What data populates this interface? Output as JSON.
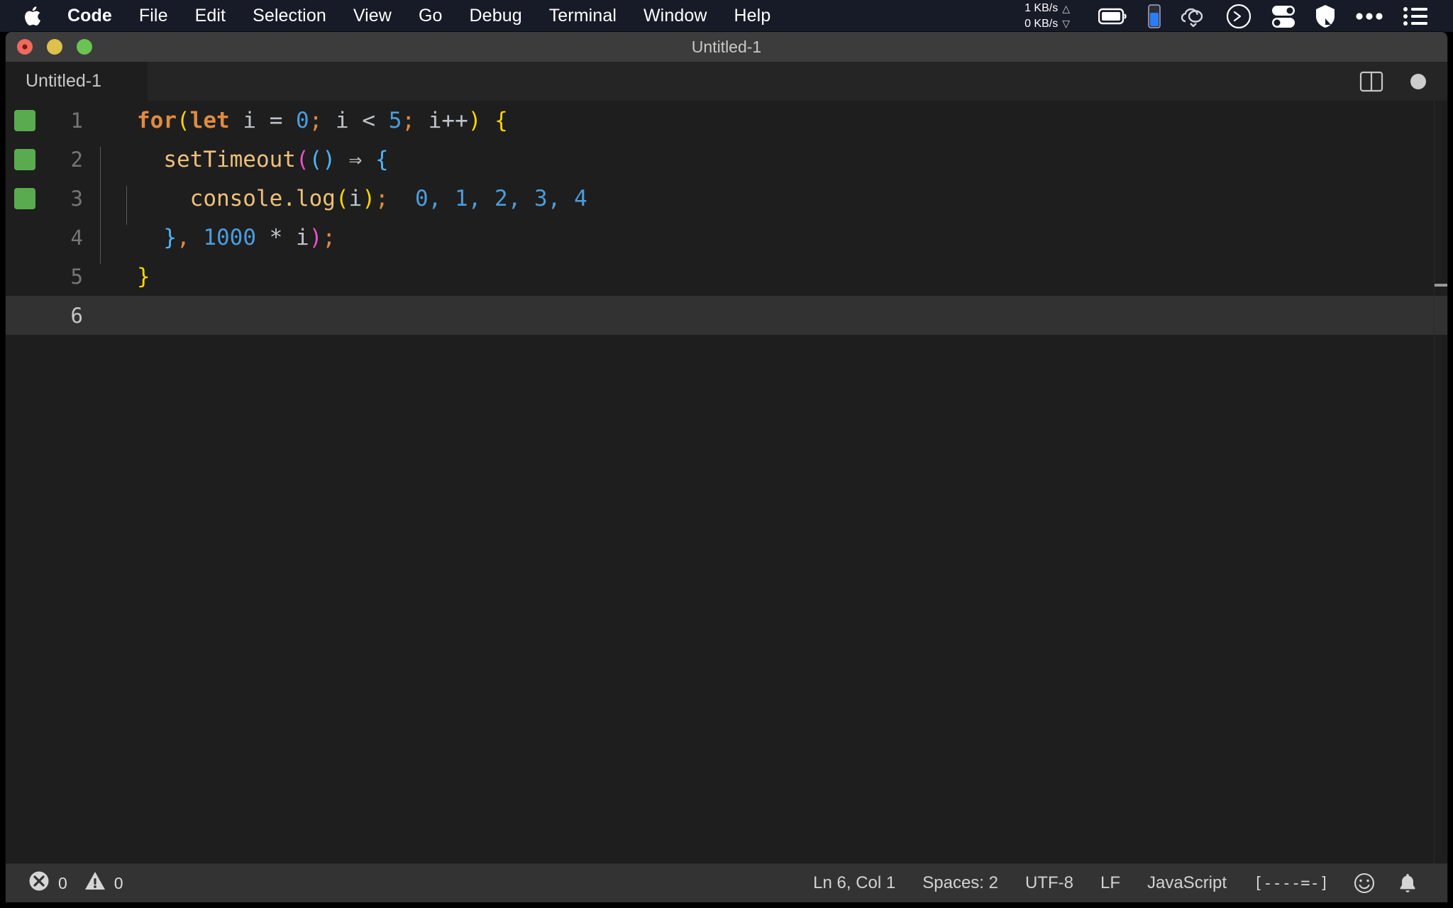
{
  "menubar": {
    "apple_icon": "apple-logo-icon",
    "items": [
      {
        "label": "Code",
        "bold": true
      },
      {
        "label": "File",
        "bold": false
      },
      {
        "label": "Edit",
        "bold": false
      },
      {
        "label": "Selection",
        "bold": false
      },
      {
        "label": "View",
        "bold": false
      },
      {
        "label": "Go",
        "bold": false
      },
      {
        "label": "Debug",
        "bold": false
      },
      {
        "label": "Terminal",
        "bold": false
      },
      {
        "label": "Window",
        "bold": false
      },
      {
        "label": "Help",
        "bold": false
      }
    ],
    "network": {
      "up": "1 KB/s",
      "down": "0 KB/s",
      "up_arrow": "△",
      "down_arrow": "▽"
    },
    "tray_icons": [
      "battery-icon",
      "battery-level-icon",
      "cloud-sync-icon",
      "clock-icon",
      "toggles-icon",
      "shield-icon",
      "ellipsis-icon",
      "list-menu-icon"
    ]
  },
  "window": {
    "title": "Untitled-1",
    "traffic_lights": [
      "close-button",
      "minimize-button",
      "maximize-button"
    ]
  },
  "tabbar": {
    "tabs": [
      {
        "label": "Untitled-1",
        "active": true,
        "dirty": true
      }
    ],
    "actions": [
      "split-editor-icon",
      "unsaved-indicator"
    ]
  },
  "editor": {
    "language": "JavaScript",
    "lines": [
      {
        "number": "1",
        "gutter": "added",
        "indent_guides": 0,
        "tokens": [
          {
            "t": "for",
            "c": "t-kw"
          },
          {
            "t": "(",
            "c": "t-paren-y"
          },
          {
            "t": "let",
            "c": "t-kw"
          },
          {
            "t": " ",
            "c": "t-plain"
          },
          {
            "t": "i",
            "c": "t-var"
          },
          {
            "t": " ",
            "c": "t-plain"
          },
          {
            "t": "=",
            "c": "t-op"
          },
          {
            "t": " ",
            "c": "t-plain"
          },
          {
            "t": "0",
            "c": "t-num"
          },
          {
            "t": ";",
            "c": "t-punc"
          },
          {
            "t": " ",
            "c": "t-plain"
          },
          {
            "t": "i",
            "c": "t-var"
          },
          {
            "t": " ",
            "c": "t-plain"
          },
          {
            "t": "<",
            "c": "t-op"
          },
          {
            "t": " ",
            "c": "t-plain"
          },
          {
            "t": "5",
            "c": "t-num"
          },
          {
            "t": ";",
            "c": "t-punc"
          },
          {
            "t": " ",
            "c": "t-plain"
          },
          {
            "t": "i",
            "c": "t-var"
          },
          {
            "t": "++",
            "c": "t-op"
          },
          {
            "t": ")",
            "c": "t-paren-y"
          },
          {
            "t": " ",
            "c": "t-plain"
          },
          {
            "t": "{",
            "c": "t-paren-y"
          }
        ]
      },
      {
        "number": "2",
        "gutter": "added",
        "indent_guides": 1,
        "tokens": [
          {
            "t": "  ",
            "c": "t-plain"
          },
          {
            "t": "setTimeout",
            "c": "t-fn"
          },
          {
            "t": "(",
            "c": "t-paren-m"
          },
          {
            "t": "(",
            "c": "t-paren-b"
          },
          {
            "t": ")",
            "c": "t-paren-b"
          },
          {
            "t": " ",
            "c": "t-plain"
          },
          {
            "t": "⇒",
            "c": "t-op"
          },
          {
            "t": " ",
            "c": "t-plain"
          },
          {
            "t": "{",
            "c": "t-brace-b"
          }
        ]
      },
      {
        "number": "3",
        "gutter": "added",
        "indent_guides": 2,
        "tokens": [
          {
            "t": "    ",
            "c": "t-plain"
          },
          {
            "t": "console",
            "c": "t-fn"
          },
          {
            "t": ".",
            "c": "t-fn"
          },
          {
            "t": "log",
            "c": "t-fn"
          },
          {
            "t": "(",
            "c": "t-paren-y"
          },
          {
            "t": "i",
            "c": "t-var"
          },
          {
            "t": ")",
            "c": "t-paren-y"
          },
          {
            "t": ";",
            "c": "t-punc"
          },
          {
            "t": "  ",
            "c": "t-plain"
          },
          {
            "t": "0",
            "c": "t-num"
          },
          {
            "t": ",",
            "c": "t-num"
          },
          {
            "t": " ",
            "c": "t-plain"
          },
          {
            "t": "1",
            "c": "t-num"
          },
          {
            "t": ",",
            "c": "t-num"
          },
          {
            "t": " ",
            "c": "t-plain"
          },
          {
            "t": "2",
            "c": "t-num"
          },
          {
            "t": ",",
            "c": "t-num"
          },
          {
            "t": " ",
            "c": "t-plain"
          },
          {
            "t": "3",
            "c": "t-num"
          },
          {
            "t": ",",
            "c": "t-num"
          },
          {
            "t": " ",
            "c": "t-plain"
          },
          {
            "t": "4",
            "c": "t-num"
          }
        ]
      },
      {
        "number": "4",
        "gutter": "none",
        "indent_guides": 1,
        "tokens": [
          {
            "t": "  ",
            "c": "t-plain"
          },
          {
            "t": "}",
            "c": "t-brace-b"
          },
          {
            "t": ",",
            "c": "t-punc"
          },
          {
            "t": " ",
            "c": "t-plain"
          },
          {
            "t": "1000",
            "c": "t-num"
          },
          {
            "t": " ",
            "c": "t-plain"
          },
          {
            "t": "*",
            "c": "t-op"
          },
          {
            "t": " ",
            "c": "t-plain"
          },
          {
            "t": "i",
            "c": "t-var"
          },
          {
            "t": ")",
            "c": "t-paren-m"
          },
          {
            "t": ";",
            "c": "t-punc"
          }
        ]
      },
      {
        "number": "5",
        "gutter": "none",
        "indent_guides": 0,
        "tokens": [
          {
            "t": "}",
            "c": "t-paren-y"
          }
        ]
      },
      {
        "number": "6",
        "gutter": "none",
        "indent_guides": 0,
        "current": true,
        "tokens": []
      }
    ]
  },
  "statusbar": {
    "errors": "0",
    "warnings": "0",
    "error_icon": "error-circle-icon",
    "warning_icon": "warning-triangle-icon",
    "cursor_position": "Ln 6, Col 1",
    "indentation": "Spaces: 2",
    "encoding": "UTF-8",
    "eol": "LF",
    "language_mode": "JavaScript",
    "layout_indicator": "[----=-]",
    "feedback_icon": "smiley-icon",
    "notifications_icon": "bell-icon"
  },
  "colors": {
    "menubar_bg": "#171a27",
    "editor_bg": "#1e1e1e",
    "tabbar_bg": "#252526",
    "statusbar_bg": "#333333",
    "titlebar_bg": "#3c3c3c",
    "gutter_added": "#5aab4f",
    "keyword": "#e08b42",
    "number": "#4b9ddb",
    "function": "#edc07b"
  }
}
